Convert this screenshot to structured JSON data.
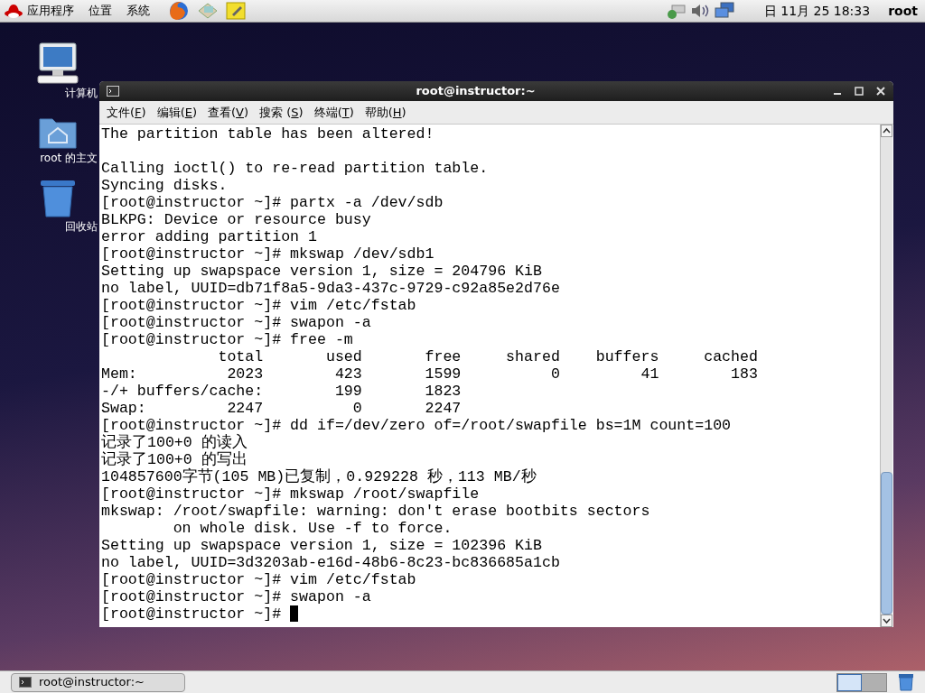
{
  "top_panel": {
    "menus": [
      "应用程序",
      "位置",
      "系统"
    ],
    "clock": "日 11月 25 18:33",
    "user": "root"
  },
  "desktop_icons": [
    {
      "kind": "computer",
      "label": "计算机"
    },
    {
      "kind": "home",
      "label": "root 的主文"
    },
    {
      "kind": "trash",
      "label": "回收站"
    }
  ],
  "window": {
    "title": "root@instructor:~",
    "menu": [
      {
        "before": "文件(",
        "key": "F",
        "after": ")"
      },
      {
        "before": "编辑(",
        "key": "E",
        "after": ")"
      },
      {
        "before": "查看(",
        "key": "V",
        "after": ")"
      },
      {
        "before": "搜索 (",
        "key": "S",
        "after": ")"
      },
      {
        "before": "终端(",
        "key": "T",
        "after": ")"
      },
      {
        "before": "帮助(",
        "key": "H",
        "after": ")"
      }
    ],
    "terminal_blocks": [
      [
        "The partition table has been altered!"
      ],
      [
        "Calling ioctl() to re-read partition table.",
        "Syncing disks.",
        "[root@instructor ~]# partx -a /dev/sdb",
        "BLKPG: Device or resource busy",
        "error adding partition 1",
        "[root@instructor ~]# mkswap /dev/sdb1",
        "Setting up swapspace version 1, size = 204796 KiB",
        "no label, UUID=db71f8a5-9da3-437c-9729-c92a85e2d76e",
        "[root@instructor ~]# vim /etc/fstab",
        "[root@instructor ~]# swapon -a",
        "[root@instructor ~]# free -m",
        "             total       used       free     shared    buffers     cached",
        "Mem:          2023        423       1599          0         41        183",
        "-/+ buffers/cache:        199       1823",
        "Swap:         2247          0       2247",
        "[root@instructor ~]# dd if=/dev/zero of=/root/swapfile bs=1M count=100",
        "记录了100+0 的读入",
        "记录了100+0 的写出",
        "104857600字节(105 MB)已复制，0.929228 秒，113 MB/秒",
        "[root@instructor ~]# mkswap /root/swapfile",
        "mkswap: /root/swapfile: warning: don't erase bootbits sectors",
        "        on whole disk. Use -f to force.",
        "Setting up swapspace version 1, size = 102396 KiB",
        "no label, UUID=3d3203ab-e16d-48b6-8c23-bc836685a1cb",
        "[root@instructor ~]# vim /etc/fstab",
        "[root@instructor ~]# swapon -a",
        "[root@instructor ~]# "
      ]
    ],
    "cursor": true
  },
  "taskbar": {
    "tasks": [
      {
        "label": "root@instructor:~",
        "selected": false
      }
    ],
    "workspaces": [
      {
        "selected": true
      },
      {
        "selected": false
      }
    ]
  }
}
